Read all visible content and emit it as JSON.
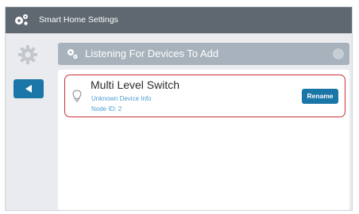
{
  "app": {
    "title": "Smart Home Settings",
    "icon": "gears-icon"
  },
  "sidebar": {
    "settings_icon": "gear-icon",
    "back_icon": "back-arrow-icon"
  },
  "panel": {
    "title": "Listening For Devices To Add",
    "header_icon": "device-search-icon",
    "info_icon": "info-icon"
  },
  "devices": [
    {
      "name": "Multi Level Switch",
      "info": "Unknown Device Info",
      "node": "Node ID: 2",
      "icon": "lightbulb-icon",
      "action_label": "Rename",
      "selected": true
    }
  ],
  "colors": {
    "titlebar": "#5f6870",
    "accent": "#1b76a8",
    "header": "#a7b2bc",
    "selection": "#c8323a",
    "link_text": "#4e9dd3"
  }
}
